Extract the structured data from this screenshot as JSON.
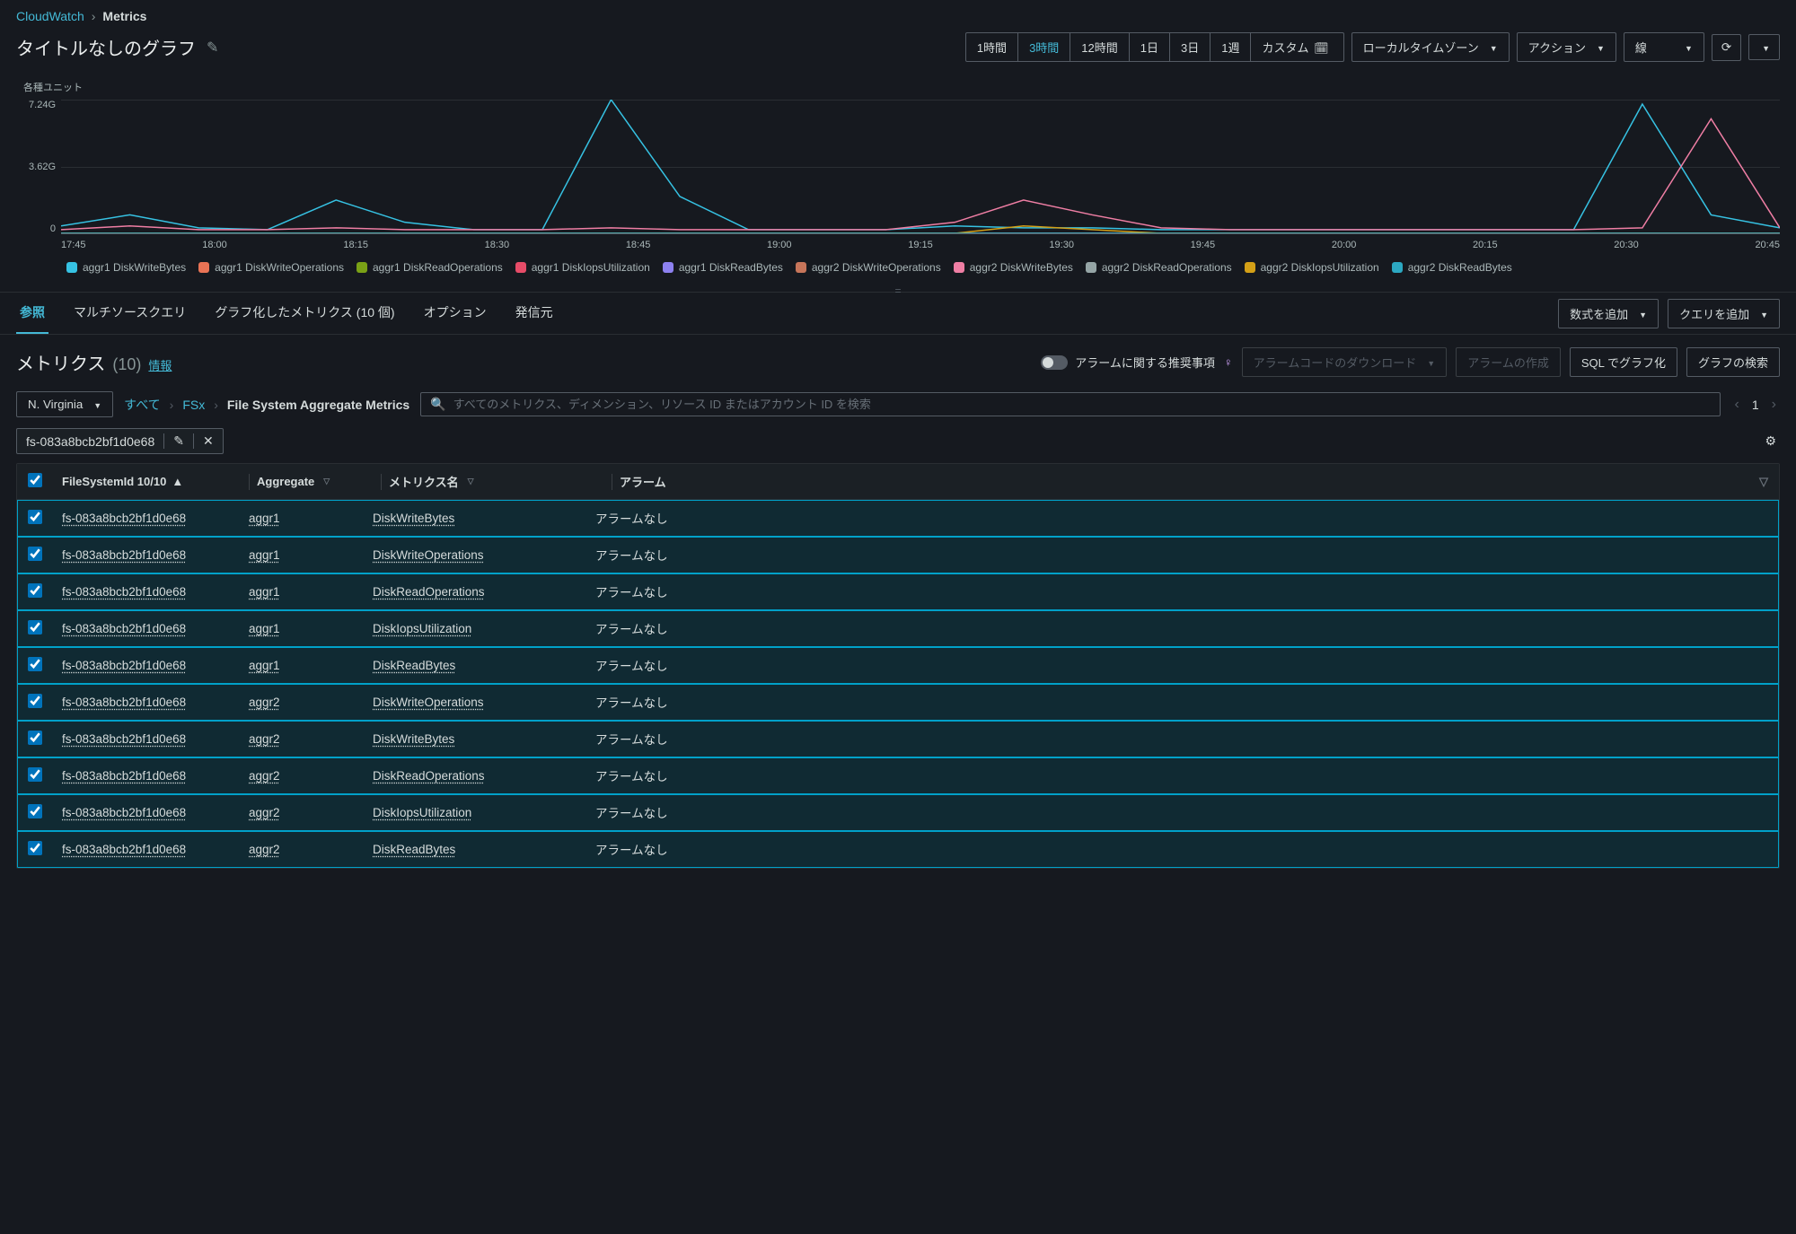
{
  "breadcrumb": {
    "root": "CloudWatch",
    "current": "Metrics"
  },
  "title": "タイトルなしのグラフ",
  "time_ranges": [
    "1時間",
    "3時間",
    "12時間",
    "1日",
    "3日",
    "1週",
    "カスタム"
  ],
  "time_range_active": 1,
  "timezone_label": "ローカルタイムゾーン",
  "action_button": "アクション",
  "chart_type": "線",
  "chart_ylabel": "各種ユニット",
  "chart_data": {
    "type": "line",
    "title": "",
    "xlabel": "",
    "ylabel": "各種ユニット",
    "ylim": [
      0,
      7.24
    ],
    "y_unit": "G",
    "yticks": [
      "7.24G",
      "3.62G",
      "0"
    ],
    "xticks": [
      "17:45",
      "18:00",
      "18:15",
      "18:30",
      "18:45",
      "19:00",
      "19:15",
      "19:30",
      "19:45",
      "20:00",
      "20:15",
      "20:30",
      "20:45"
    ],
    "series": [
      {
        "name": "aggr1 DiskWriteBytes",
        "color": "#36c2e3",
        "values": [
          0.4,
          1.0,
          0.3,
          0.2,
          1.8,
          0.6,
          0.2,
          0.2,
          7.24,
          2.0,
          0.2,
          0.2,
          0.2,
          0.4,
          0.3,
          0.3,
          0.2,
          0.2,
          0.2,
          0.2,
          0.2,
          0.2,
          0.2,
          7.0,
          1.0,
          0.3
        ]
      },
      {
        "name": "aggr1 DiskWriteOperations",
        "color": "#e97355",
        "values": [
          0,
          0,
          0,
          0,
          0,
          0,
          0,
          0,
          0,
          0,
          0,
          0,
          0,
          0,
          0,
          0,
          0,
          0,
          0,
          0,
          0,
          0,
          0,
          0,
          0,
          0
        ]
      },
      {
        "name": "aggr1 DiskReadOperations",
        "color": "#7aa116",
        "values": [
          0,
          0,
          0,
          0,
          0,
          0,
          0,
          0,
          0,
          0,
          0,
          0,
          0,
          0,
          0,
          0,
          0,
          0,
          0,
          0,
          0,
          0,
          0,
          0,
          0,
          0
        ]
      },
      {
        "name": "aggr1 DiskIopsUtilization",
        "color": "#e74c68",
        "values": [
          0,
          0,
          0,
          0,
          0,
          0,
          0,
          0,
          0,
          0,
          0,
          0,
          0,
          0,
          0,
          0,
          0,
          0,
          0,
          0,
          0,
          0,
          0,
          0,
          0,
          0
        ]
      },
      {
        "name": "aggr1 DiskReadBytes",
        "color": "#8d81f0",
        "values": [
          0,
          0,
          0,
          0,
          0,
          0,
          0,
          0,
          0,
          0,
          0,
          0,
          0,
          0,
          0,
          0,
          0,
          0,
          0,
          0,
          0,
          0,
          0,
          0,
          0,
          0
        ]
      },
      {
        "name": "aggr2 DiskWriteOperations",
        "color": "#c7755a",
        "values": [
          0,
          0,
          0,
          0,
          0,
          0,
          0,
          0,
          0,
          0,
          0,
          0,
          0,
          0,
          0,
          0,
          0,
          0,
          0,
          0,
          0,
          0,
          0,
          0,
          0,
          0
        ]
      },
      {
        "name": "aggr2 DiskWriteBytes",
        "color": "#ef7ea4",
        "values": [
          0.2,
          0.4,
          0.2,
          0.2,
          0.3,
          0.2,
          0.2,
          0.2,
          0.3,
          0.2,
          0.2,
          0.2,
          0.2,
          0.6,
          1.8,
          1.0,
          0.3,
          0.2,
          0.2,
          0.2,
          0.2,
          0.2,
          0.2,
          0.3,
          6.2,
          0.3
        ]
      },
      {
        "name": "aggr2 DiskReadOperations",
        "color": "#95a5a6",
        "values": [
          0,
          0,
          0,
          0,
          0,
          0,
          0,
          0,
          0,
          0,
          0,
          0,
          0,
          0,
          0,
          0,
          0,
          0,
          0,
          0,
          0,
          0,
          0,
          0,
          0,
          0
        ]
      },
      {
        "name": "aggr2 DiskIopsUtilization",
        "color": "#d4a017",
        "values": [
          0,
          0,
          0,
          0,
          0,
          0,
          0,
          0,
          0,
          0,
          0,
          0,
          0,
          0,
          0.4,
          0.2,
          0,
          0,
          0,
          0,
          0,
          0,
          0,
          0,
          0,
          0
        ]
      },
      {
        "name": "aggr2 DiskReadBytes",
        "color": "#2ca8c2",
        "values": [
          0,
          0,
          0,
          0,
          0,
          0,
          0,
          0,
          0,
          0,
          0,
          0,
          0,
          0,
          0,
          0,
          0,
          0,
          0,
          0,
          0,
          0,
          0,
          0,
          0,
          0
        ]
      }
    ]
  },
  "mid_tabs": {
    "active": 0,
    "items": [
      "参照",
      "マルチソースクエリ",
      "グラフ化したメトリクス (10 個)",
      "オプション",
      "発信元"
    ],
    "add_math": "数式を追加",
    "add_query": "クエリを追加"
  },
  "metrics_section": {
    "title": "メトリクス",
    "count": "(10)",
    "info": "情報",
    "alarm_toggle": "アラームに関する推奨事項",
    "download_alarm_code": "アラームコードのダウンロード",
    "create_alarm": "アラームの作成",
    "sql_graph": "SQL でグラフ化",
    "search_graph": "グラフの検索"
  },
  "region": "N. Virginia",
  "nav_crumb": {
    "all": "すべて",
    "service": "FSx",
    "current": "File System Aggregate Metrics"
  },
  "search_placeholder": "すべてのメトリクス、ディメンション、リソース ID またはアカウント ID を検索",
  "page_number": "1",
  "filter_chip": "fs-083a8bcb2bf1d0e68",
  "table": {
    "columns": {
      "fs": "FileSystemId 10/10",
      "agg": "Aggregate",
      "mn": "メトリクス名",
      "al": "アラーム"
    },
    "rows": [
      {
        "fs": "fs-083a8bcb2bf1d0e68",
        "agg": "aggr1",
        "mn": "DiskWriteBytes",
        "al": "アラームなし"
      },
      {
        "fs": "fs-083a8bcb2bf1d0e68",
        "agg": "aggr1",
        "mn": "DiskWriteOperations",
        "al": "アラームなし"
      },
      {
        "fs": "fs-083a8bcb2bf1d0e68",
        "agg": "aggr1",
        "mn": "DiskReadOperations",
        "al": "アラームなし"
      },
      {
        "fs": "fs-083a8bcb2bf1d0e68",
        "agg": "aggr1",
        "mn": "DiskIopsUtilization",
        "al": "アラームなし"
      },
      {
        "fs": "fs-083a8bcb2bf1d0e68",
        "agg": "aggr1",
        "mn": "DiskReadBytes",
        "al": "アラームなし"
      },
      {
        "fs": "fs-083a8bcb2bf1d0e68",
        "agg": "aggr2",
        "mn": "DiskWriteOperations",
        "al": "アラームなし"
      },
      {
        "fs": "fs-083a8bcb2bf1d0e68",
        "agg": "aggr2",
        "mn": "DiskWriteBytes",
        "al": "アラームなし"
      },
      {
        "fs": "fs-083a8bcb2bf1d0e68",
        "agg": "aggr2",
        "mn": "DiskReadOperations",
        "al": "アラームなし"
      },
      {
        "fs": "fs-083a8bcb2bf1d0e68",
        "agg": "aggr2",
        "mn": "DiskIopsUtilization",
        "al": "アラームなし"
      },
      {
        "fs": "fs-083a8bcb2bf1d0e68",
        "agg": "aggr2",
        "mn": "DiskReadBytes",
        "al": "アラームなし"
      }
    ]
  }
}
